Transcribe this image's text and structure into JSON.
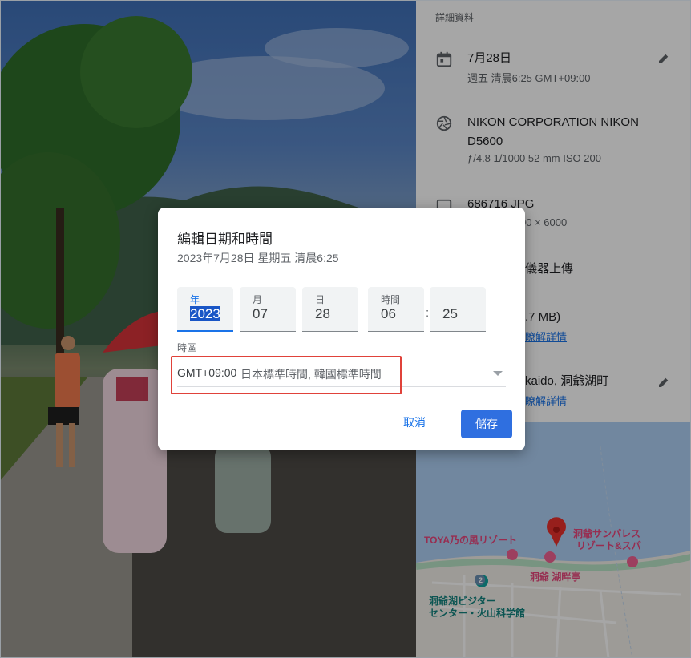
{
  "panel": {
    "section_title": "詳細資料",
    "date": {
      "title": "7月28日",
      "subtitle": "週五 清晨6:25   GMT+09:00"
    },
    "camera": {
      "title": "NIKON CORPORATION NIKON D5600",
      "subtitle": "ƒ/4.8   1/1000   52 mm   ISO 200"
    },
    "file": {
      "title": "686716  JPG",
      "subtitle": "00 × 6000"
    },
    "upload": {
      "title": "儀器上傳"
    },
    "backup": {
      "title": ".7 MB)",
      "link": "瞭解詳情"
    },
    "location": {
      "title": "kaido, 洞爺湖町",
      "link": "瞭解詳情"
    }
  },
  "map": {
    "labels": [
      "TOYA乃の風リゾート",
      "洞爺サンパレス",
      "リゾート&スパ",
      "洞爺 湖畔亭",
      "洞爺湖ビジター",
      "センター・火山科学館"
    ],
    "road_number": "2"
  },
  "dialog": {
    "title": "編輯日期和時間",
    "subtitle": "2023年7月28日 星期五 清晨6:25",
    "fields": [
      {
        "label": "年",
        "value": "2023"
      },
      {
        "label": "月",
        "value": "07"
      },
      {
        "label": "日",
        "value": "28"
      },
      {
        "label": "時間",
        "value": "06"
      },
      {
        "label": "",
        "value": "25"
      }
    ],
    "time_separator": ":",
    "timezone_label": "時區",
    "timezone_offset": "GMT+09:00",
    "timezone_name": "日本標準時間, 韓國標準時間",
    "cancel_label": "取消",
    "save_label": "儲存"
  },
  "colors": {
    "accent": "#1a73e8",
    "save_button": "#2f6fe0",
    "highlight_box": "#e0423a"
  }
}
